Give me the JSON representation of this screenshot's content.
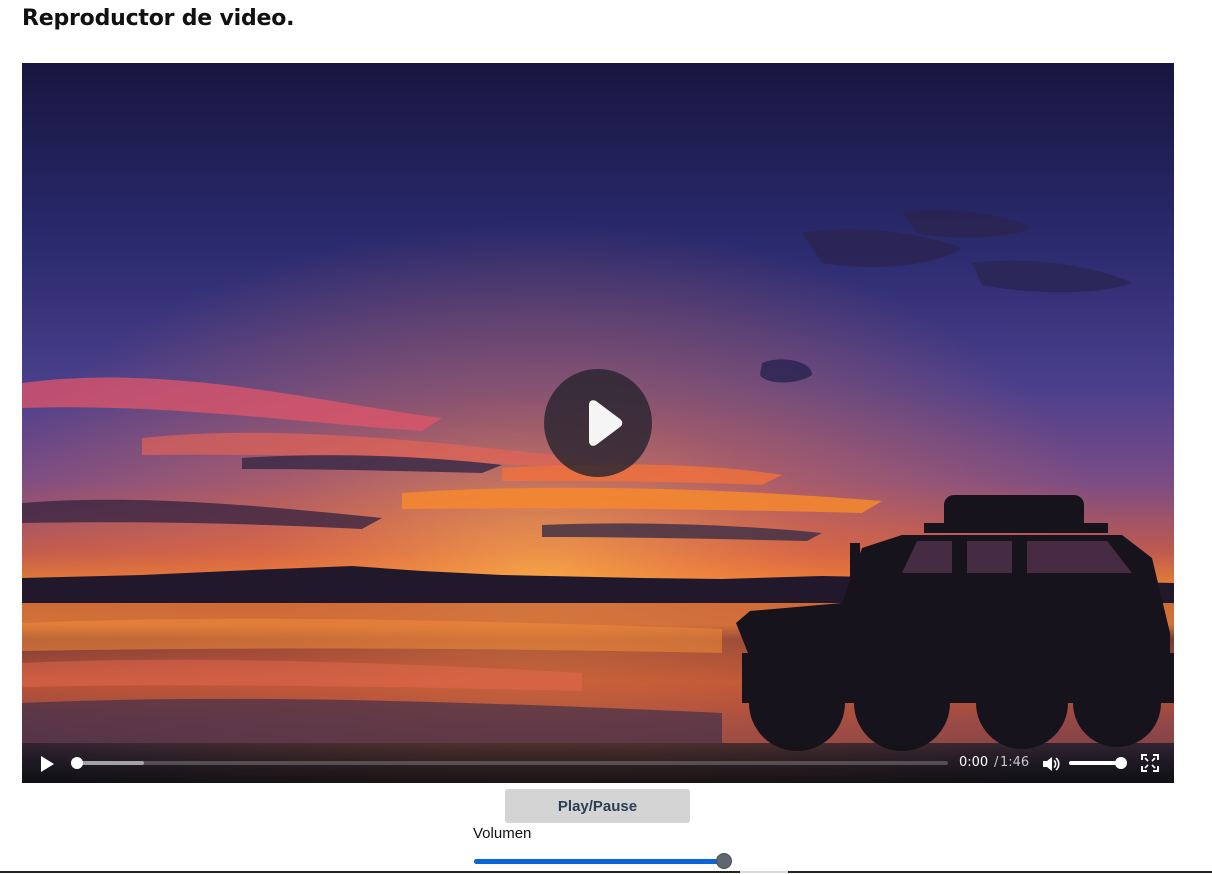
{
  "page": {
    "title": "Reproductor de video."
  },
  "video": {
    "current_time": "0:00",
    "time_separator": "/",
    "duration": "1:46",
    "progress_fraction": 0.0,
    "buffered_fraction": 0.078,
    "player_volume_fraction": 1.0,
    "big_play_icon": "play-icon",
    "controls": {
      "play_icon": "play-icon",
      "volume_icon": "speaker-icon",
      "fullscreen_icon": "fullscreen-icon"
    }
  },
  "below_video": {
    "playpause_label": "Play/Pause",
    "volume_label": "Volumen",
    "volume_value_fraction": 1.0
  },
  "colors": {
    "slider_blue": "#0a66d6",
    "button_gray": "#d4d4d4",
    "button_text": "#2c3e55"
  }
}
